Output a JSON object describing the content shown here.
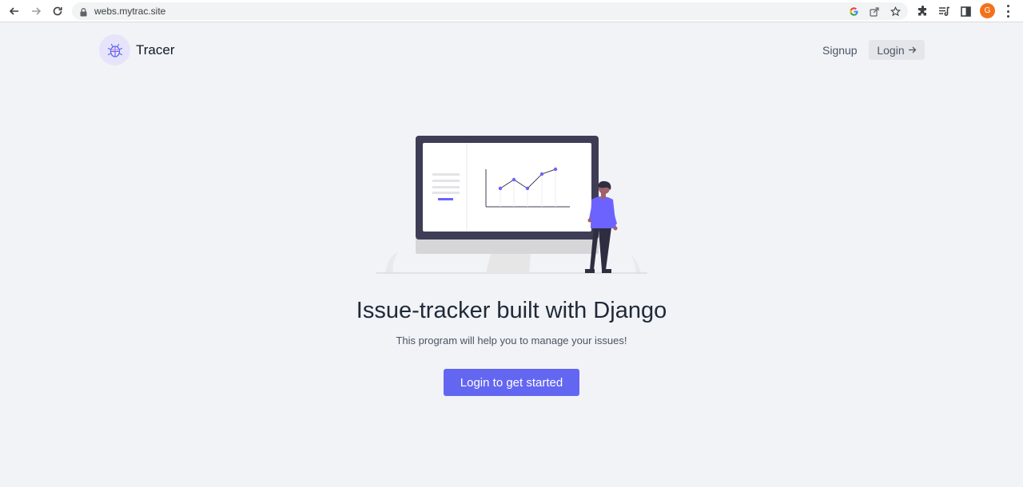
{
  "browser": {
    "url": "webs.mytrac.site",
    "profile_initial": "G"
  },
  "header": {
    "brand": "Tracer",
    "signup_label": "Signup",
    "login_label": "Login"
  },
  "hero": {
    "title": "Issue-tracker built with Django",
    "subtitle": "This program will help you to manage your issues!",
    "cta_label": "Login to get started"
  },
  "colors": {
    "accent": "#6366f1",
    "background": "#f1f3f7",
    "monitor_frame": "#3f3d56",
    "profile": "#f2721c"
  },
  "icons": {
    "logo": "bug-icon",
    "login_arrow": "arrow-right-icon"
  }
}
